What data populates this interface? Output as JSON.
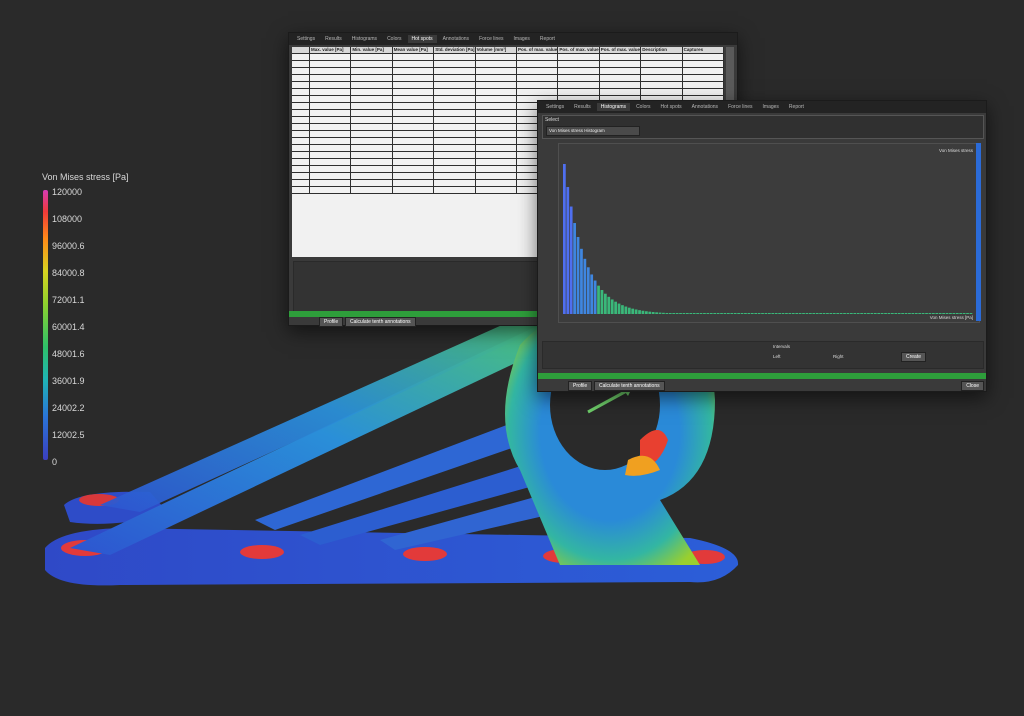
{
  "legend": {
    "title": "Von Mises stress [Pa]",
    "labels": [
      "120000",
      "108000",
      "96000.6",
      "84000.8",
      "72001.1",
      "60001.4",
      "48001.6",
      "36001.9",
      "24002.2",
      "12002.5",
      "0"
    ]
  },
  "win1": {
    "tabs": [
      "Settings",
      "Results",
      "Histograms",
      "Colors",
      "Hot spots",
      "Annotations",
      "Force lines",
      "Images",
      "Report"
    ],
    "active_tab": "Hot spots",
    "headers": [
      "Max. value [Pa]",
      "Min. value [Pa]",
      "Mean value [Pa]",
      "Std. deviation [Pa]",
      "Volume [mm³]",
      "Pos. of max. value x [mm]",
      "Pos. of max. value y [mm]",
      "Pos. of max. value z [mm]",
      "Description",
      "Captures"
    ],
    "rows": 20,
    "button_profile": "Profile",
    "button_calc": "Calculate tenth annotations"
  },
  "win2": {
    "tabs": [
      "Settings",
      "Results",
      "Histograms",
      "Colors",
      "Hot spots",
      "Annotations",
      "Force lines",
      "Images",
      "Report"
    ],
    "active_tab": "Histograms",
    "select_label": "Select",
    "select_value": "Von Mises stress Histogram",
    "chart_label_top": "Von Mises stress",
    "chart_label_bottom": "Von Mises stress [Pa]",
    "interval_label": "Intervals",
    "left_label": "Left",
    "right_label": "Right",
    "create_label": "Create",
    "button_profile": "Profile",
    "button_calc": "Calculate tenth annotations",
    "close_label": "Close"
  }
}
